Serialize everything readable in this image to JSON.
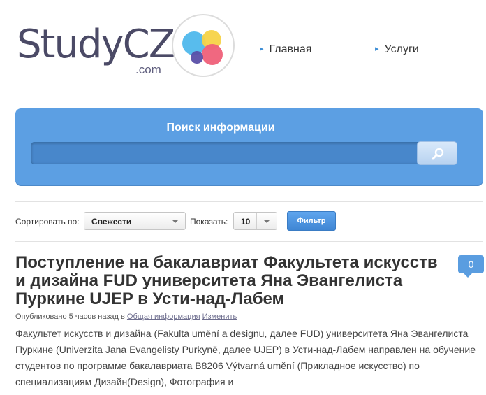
{
  "header": {
    "logo_text": "StudyCZ",
    "logo_suffix": ".com",
    "nav": [
      {
        "label": "Главная"
      },
      {
        "label": "Услуги"
      }
    ]
  },
  "search": {
    "title": "Поиск информации",
    "value": "",
    "button_icon": "search-icon"
  },
  "sort": {
    "sort_label": "Сортировать по:",
    "sort_value": "Свежести",
    "show_label": "Показать:",
    "show_value": "10",
    "filter_label": "Фильтр"
  },
  "article": {
    "title": "Поступление на бакалавриат Факультета искусств и дизайна FUD университета Яна Эвангелиста Пуркине UJEP в Усти-над-Лабем",
    "comments": "0",
    "published_prefix": "Опубликовано 5 часов назад в",
    "category": "Общая информация",
    "edit": "Изменить",
    "excerpt": "Факультет искусств и дизайна (Fakulta umění a designu, далее FUD) университета Яна Эвангелиста Пуркине (Univerzita Jana Evangelisty Purkyně, далее UJEP) в Усти-над-Лабем направлен на обучение студентов по программе бакалавриата B8206 Výtvarná umění (Прикладное искусство) по специализациям Дизайн(Design), Фотография и"
  },
  "colors": {
    "accent": "#5c9fe3",
    "logo_text": "#4b4a66",
    "logo_blue": "#4fb8ec",
    "logo_yellow": "#f7d347",
    "logo_red": "#ef6079",
    "logo_purple": "#5a4fa8"
  }
}
